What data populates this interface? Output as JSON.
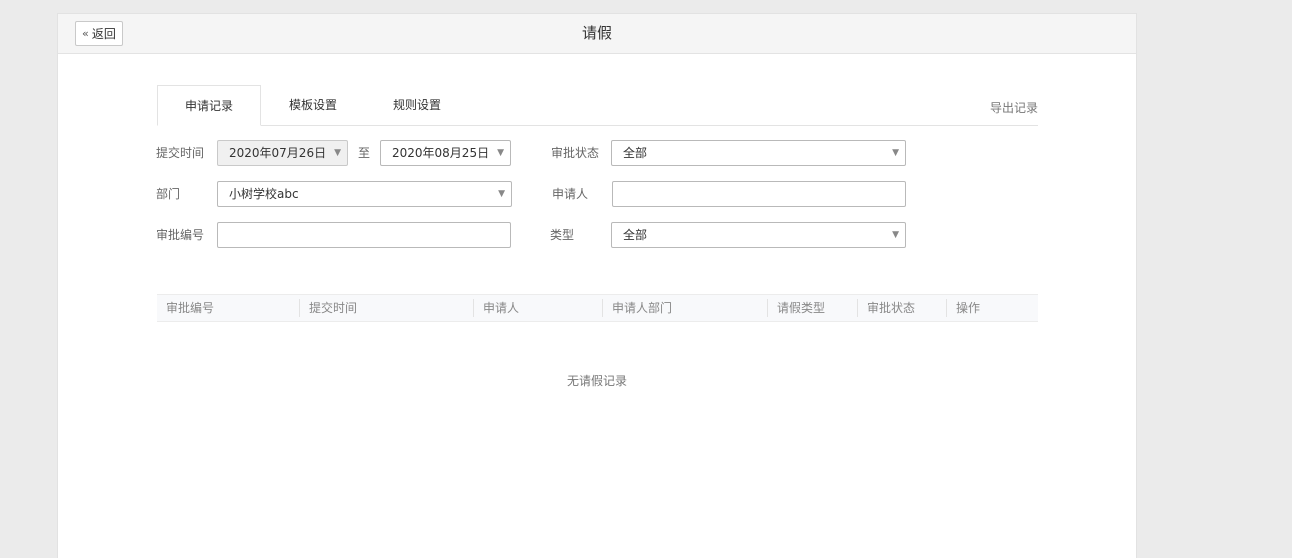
{
  "header": {
    "back_label": "返回",
    "title": "请假"
  },
  "tabs": [
    {
      "label": "申请记录",
      "active": true
    },
    {
      "label": "模板设置",
      "active": false
    },
    {
      "label": "规则设置",
      "active": false
    }
  ],
  "export_label": "导出记录",
  "filters": {
    "submit_time_label": "提交时间",
    "date_from": "2020年07月26日",
    "date_to_sep": "至",
    "date_to": "2020年08月25日",
    "approval_status_label": "审批状态",
    "approval_status_value": "全部",
    "department_label": "部门",
    "department_value": "小树学校abc",
    "applicant_label": "申请人",
    "applicant_value": "",
    "approval_no_label": "审批编号",
    "approval_no_value": "",
    "type_label": "类型",
    "type_value": "全部"
  },
  "table": {
    "columns": [
      "审批编号",
      "提交时间",
      "申请人",
      "申请人部门",
      "请假类型",
      "审批状态",
      "操作"
    ],
    "empty_text": "无请假记录"
  },
  "icons": {
    "back": "double-chevron-left-icon",
    "dropdown": "caret-down-icon"
  }
}
